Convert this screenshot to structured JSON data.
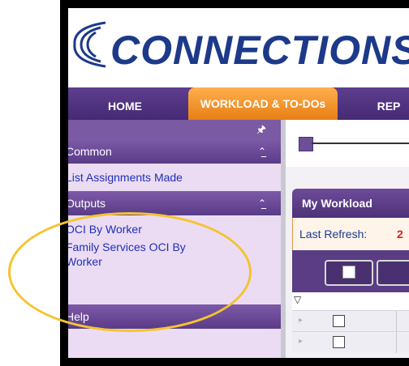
{
  "app": {
    "title": "CONNECTIONS",
    "logo_icon": "connections-logo-icon"
  },
  "tabs": [
    {
      "label": "HOME"
    },
    {
      "label": "WORKLOAD & TO-DOs"
    },
    {
      "label": "REP"
    }
  ],
  "left_panel": {
    "pin_icon": "pin-icon",
    "sections": [
      {
        "label": "Common",
        "chevron_icon": "chevron-up-double-icon",
        "links": [
          "List Assignments Made"
        ]
      },
      {
        "label": "Outputs",
        "chevron_icon": "chevron-up-double-icon",
        "links": [
          "OCI By Worker",
          "Family Services OCI By",
          "Worker"
        ]
      },
      {
        "label": "Help"
      }
    ]
  },
  "right_panel": {
    "workload_title": "My Workload",
    "refresh_label": "Last Refresh:",
    "refresh_value": "2",
    "filter_icon": "filter-icon"
  },
  "colors": {
    "brand_blue": "#1d3a8a",
    "tab_active": "#e77e14",
    "nav_purple": "#5e3e8e",
    "panel_bg": "#ebdcf3",
    "link_blue": "#1f2fb8",
    "highlight": "#f4c430",
    "refresh_value": "#d32020"
  }
}
